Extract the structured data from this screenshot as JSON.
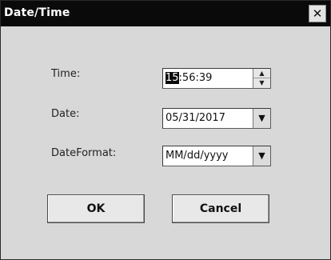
{
  "window": {
    "title": "Date/Time",
    "close_glyph": "✕"
  },
  "form": {
    "time_label": "Time:",
    "time_value_selected": "15",
    "time_value_rest": ":56:39",
    "date_label": "Date:",
    "date_value": "05/31/2017",
    "format_label": "DateFormat:",
    "format_value": "MM/dd/yyyy"
  },
  "buttons": {
    "ok_label": "OK",
    "cancel_label": "Cancel"
  },
  "icons": {
    "spin_up": "▲",
    "spin_down": "▼",
    "dropdown": "▼"
  }
}
